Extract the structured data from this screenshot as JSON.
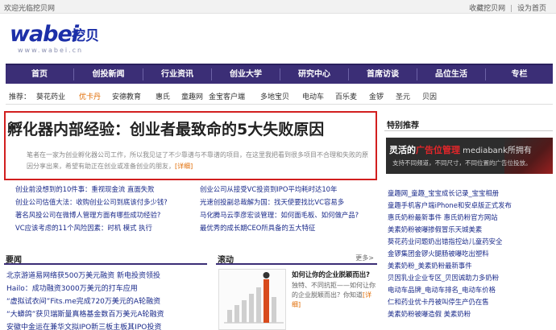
{
  "topbar": {
    "welcome": "欢迎光临挖贝网",
    "bookmark": "收藏挖贝网",
    "separator": "|",
    "homepage": "设为首页"
  },
  "logo": {
    "brand": "wabei",
    "brand_cn": "挖贝",
    "url": "www.wabei.cn"
  },
  "nav": {
    "items": [
      "首页",
      "创投新闻",
      "行业资讯",
      "创业大学",
      "研究中心",
      "首席访谈",
      "品位生活",
      "专栏"
    ]
  },
  "subnav": {
    "label": "推荐：",
    "links": [
      "葵花药业",
      "优卡丹",
      "安德教育",
      "惠氏",
      "童趣网",
      "金宝客户端",
      "多地宝贝",
      "电动车",
      "百乐麦",
      "金锣",
      "圣元",
      "贝因"
    ],
    "hot_index": 1
  },
  "headline": {
    "title": "孵化器内部经验：创业者最致命的5大失败原因",
    "summary": "笔者在一家为创业孵化器公司工作，所以我见证了不少靠谱与不靠谱的项目，在这里我把看到很多项目不合理和失败的原因分享出来，希望有助正在创业或准备创业的朋友，",
    "more": "[详细]"
  },
  "news": {
    "left": [
      "创业前没想到的10件事：重视现金流 直面失败",
      "创业公司估值大法：收购创业公司到底该付多少钱?",
      "著名风投公司在微博人管理方面有哪些成功经验?",
      "VC应该考虑的11个风险因素：时机 模式 执行"
    ],
    "right": [
      "创业公司从接受VC投资到IPO平均耗时达10年",
      "光速创投副总裁解为国：找天使要找比VC容易多",
      "马化腾马云李彦宏谈管理：如何面毛板、如何做产品?",
      "最优秀的成长期CEO所具备的五大特征"
    ]
  },
  "yaowen": {
    "title": "要闻",
    "items": [
      "北京游道易网络获500万美元融资 新电投资领投",
      "Hailo：成功融资3000万美元的打车应用",
      "“虚拟试衣间”Fits.me完成720万美元的A轮融资",
      "“大蟒鸽”获贝瑞斯量真格基金数百万美元A轮融资",
      "安徽中金运在兼华文拟IPO新三板主板其IPO投资"
    ]
  },
  "gundong": {
    "title": "滚动",
    "more": "更多>",
    "pic_title": "如何让你的企业脱颖而出?",
    "pic_desc": "独特、不同抗拒——如何让你的企业脱颖而出？你知道",
    "pic_more": "[详细]"
  },
  "right": {
    "title": "特别推荐",
    "ad": {
      "headline_a": "灵活的",
      "headline_b": "广告位管理",
      "headline_c": " mediabank所拥有",
      "sub": "支持不同频道，不同尺寸，不同位置的广告位投放。"
    },
    "items": [
      "童趣网_童趣_宝宝成长记录_宝宝相册",
      "童趣手机客户端iPhone和安卓版正式发布",
      "惠氏奶粉最新事件 惠氏奶粉官方网站",
      "美素奶粉被曝掺假冒乐天城美素",
      "葵花药业问题奶出错指控幼儿童药安全",
      "金锣集团金锣火腿肠被曝吃出塑料",
      "美素奶粉_美素奶粉最新事件",
      "贝因乳业企业专区_贝因诚助力多奶粉",
      "电动车品牌_电动车排名_电动车价格",
      "仁和药业优卡丹被叫停生产仍在售",
      "美素奶粉被曝造假 美素奶粉"
    ]
  }
}
